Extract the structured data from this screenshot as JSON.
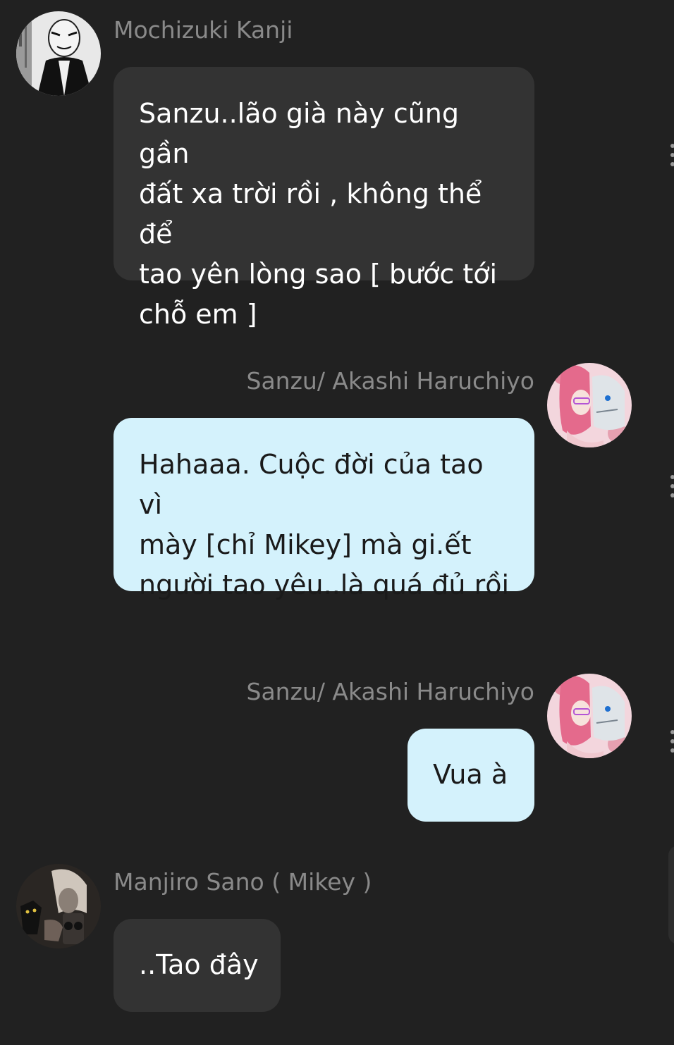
{
  "messages": [
    {
      "sender": "Mochizuki Kanji",
      "text": "Sanzu..lão già này cũng gần\nđất xa trời rồi , không thể để\ntao yên lòng sao [ bước tới\nchỗ em ]"
    },
    {
      "sender": "Sanzu/ Akashi Haruchiyo",
      "text": "Hahaaa. Cuộc đời của tao vì\nmày [chỉ Mikey] mà gi.ết\nngười tao yêu..là quá đủ rồi"
    },
    {
      "sender": "Sanzu/ Akashi Haruchiyo",
      "text": "Vua à"
    },
    {
      "sender": "Manjiro Sano ( Mikey  )",
      "text": "..Tao đây"
    }
  ],
  "avatars": {
    "mochizuki": "manga-portrait-avatar",
    "sanzu": "pink-hair-character-avatar",
    "mikey": "dark-figure-with-gun-avatar"
  },
  "colors": {
    "background": "#212121",
    "character_bubble": "#333333",
    "user_bubble": "#d4f2fc",
    "name_text": "#8a8a8a"
  }
}
